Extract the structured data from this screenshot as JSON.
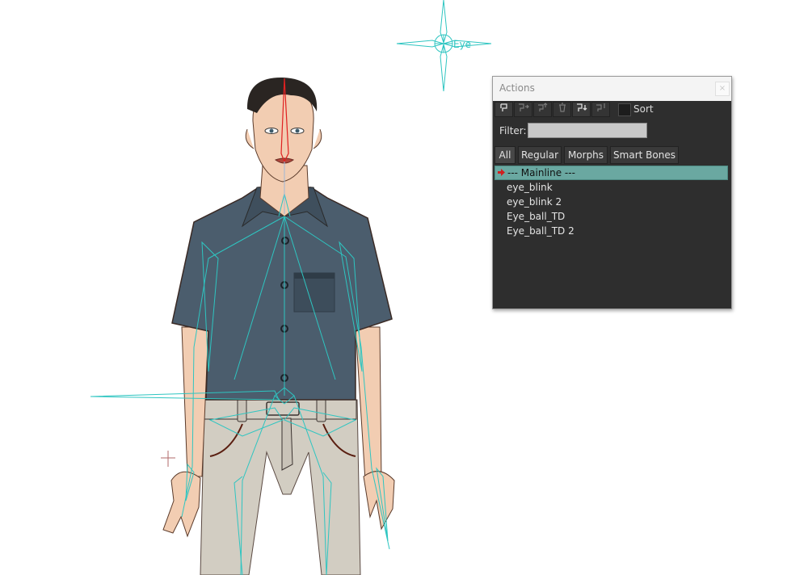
{
  "panel": {
    "title": "Actions",
    "close_glyph": "×",
    "toolbar": {
      "buttons": [
        {
          "icon": "new-action-icon"
        },
        {
          "icon": "insert-copy-icon"
        },
        {
          "icon": "duplicate-icon"
        },
        {
          "icon": "delete-icon"
        },
        {
          "icon": "insert-action-icon"
        },
        {
          "icon": "insert-reference-icon"
        }
      ],
      "sort_label": "Sort"
    },
    "filter": {
      "label": "Filter:",
      "value": ""
    },
    "tabs": [
      "All",
      "Regular",
      "Morphs",
      "Smart Bones"
    ],
    "items": [
      "--- Mainline ---",
      "eye_blink",
      "eye_blink 2",
      "Eye_ball_TD",
      "Eye_ball_TD 2"
    ],
    "selected_index": 0
  },
  "canvas": {
    "bone_label": "Eye",
    "colors": {
      "bone": "#2ec5c1",
      "selected_bone": "#e02020",
      "shirt": "#4b5d6d",
      "pants": "#d2cdc2",
      "skin": "#f2cdb2",
      "hair": "#2a2522"
    }
  }
}
